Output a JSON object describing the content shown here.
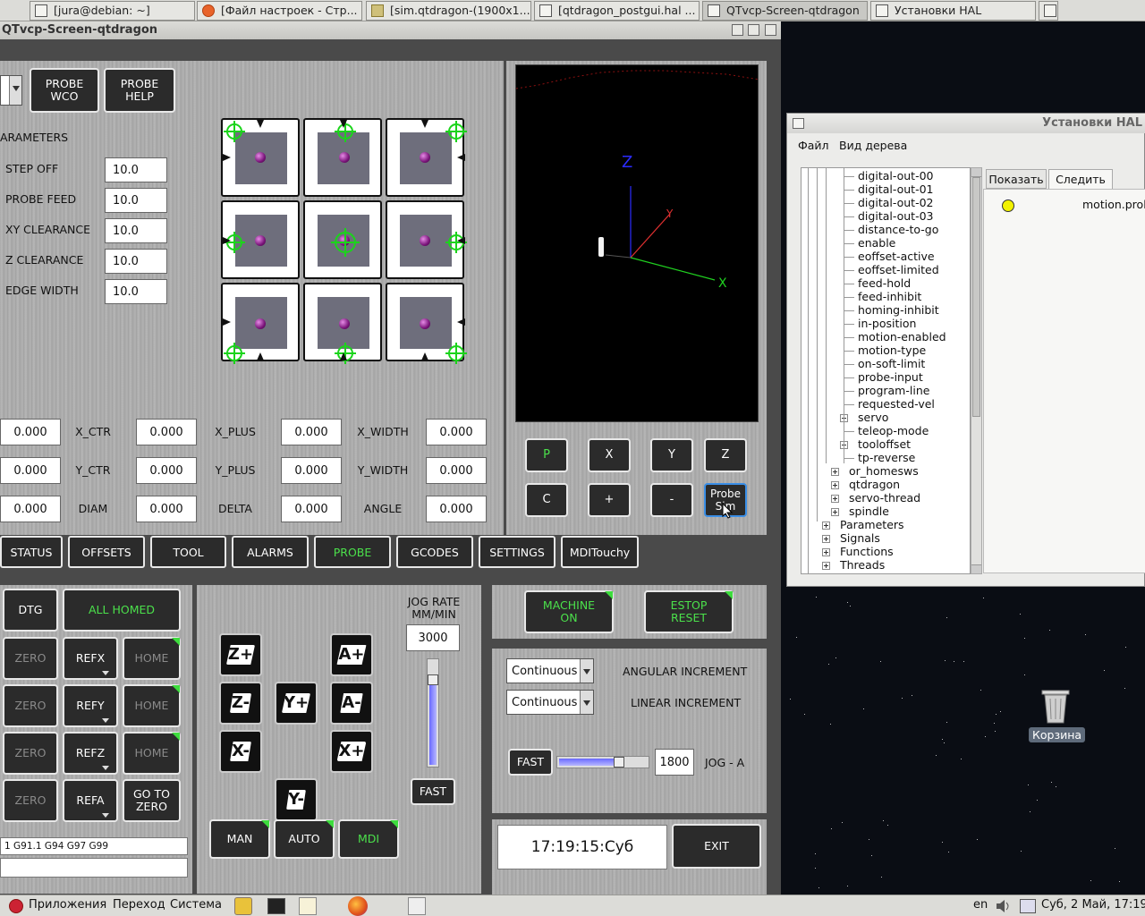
{
  "taskbar_top": {
    "items": [
      {
        "label": "[jura@debian: ~]",
        "icon": "terminal-icon"
      },
      {
        "label": "[Файл настроек - Стр...",
        "icon": "firefox-icon"
      },
      {
        "label": "[sim.qtdragon-(1900x1...",
        "icon": "folder-icon"
      },
      {
        "label": "[qtdragon_postgui.hal ...",
        "icon": "text-editor-icon"
      },
      {
        "label": "QTvcp-Screen-qtdragon",
        "icon": "window-icon"
      },
      {
        "label": "Установки HAL",
        "icon": "window-icon"
      }
    ]
  },
  "qt_window": {
    "title": "QTvcp-Screen-qtdragon",
    "probe_buttons": [
      "PROBE\nWCO",
      "PROBE\nHELP"
    ],
    "parameters_title": "ARAMETERS",
    "parameters": [
      {
        "label": "STEP OFF",
        "value": "10.0"
      },
      {
        "label": "PROBE FEED",
        "value": "10.0"
      },
      {
        "label": "XY CLEARANCE",
        "value": "10.0"
      },
      {
        "label": "Z CLEARANCE",
        "value": "10.0"
      },
      {
        "label": "EDGE WIDTH",
        "value": "10.0"
      }
    ],
    "results": [
      [
        {
          "v": "0.000"
        },
        {
          "l": "X_CTR"
        },
        {
          "v": "0.000"
        },
        {
          "l": "X_PLUS"
        },
        {
          "v": "0.000"
        },
        {
          "l": "X_WIDTH"
        },
        {
          "v": "0.000"
        }
      ],
      [
        {
          "v": "0.000"
        },
        {
          "l": "Y_CTR"
        },
        {
          "v": "0.000"
        },
        {
          "l": "Y_PLUS"
        },
        {
          "v": "0.000"
        },
        {
          "l": "Y_WIDTH"
        },
        {
          "v": "0.000"
        }
      ],
      [
        {
          "v": "0.000"
        },
        {
          "l": "DIAM"
        },
        {
          "v": "0.000"
        },
        {
          "l": "DELTA"
        },
        {
          "v": "0.000"
        },
        {
          "l": "ANGLE"
        },
        {
          "v": "0.000"
        }
      ]
    ],
    "view_buttons": [
      "P",
      "X",
      "Y",
      "Z",
      "C",
      "+",
      "-",
      "Probe\nSim"
    ],
    "axis_labels": {
      "x": "X",
      "y": "Y",
      "z": "Z"
    },
    "tabs": [
      "STATUS",
      "OFFSETS",
      "TOOL",
      "ALARMS",
      "PROBE",
      "GCODES",
      "SETTINGS",
      "MDITouchy"
    ],
    "active_tab": "PROBE",
    "dro": {
      "dtg": "DTG",
      "all_homed": "ALL HOMED",
      "rows": [
        {
          "zero": "ZERO",
          "ref": "REFX",
          "home": "HOME"
        },
        {
          "zero": "ZERO",
          "ref": "REFY",
          "home": "HOME"
        },
        {
          "zero": "ZERO",
          "ref": "REFZ",
          "home": "HOME"
        },
        {
          "zero": "ZERO",
          "ref": "REFA",
          "home": "GO TO\nZERO"
        }
      ],
      "gcode_line": "1 G91.1 G94 G97 G99"
    },
    "jog": {
      "buttons": [
        "Z+",
        "Z-",
        "A+",
        "A-",
        "Y+",
        "X-",
        "X+",
        "Y-"
      ],
      "rate_label": "JOG RATE\nMM/MIN",
      "rate_value": "3000",
      "rate_slider_fraction": 0.84,
      "fast_label": "FAST",
      "modes": [
        "MAN",
        "AUTO",
        "MDI"
      ],
      "active_mode": "MDI"
    },
    "machine": {
      "machine_on": "MACHINE\nON",
      "estop_reset": "ESTOP\nRESET",
      "angular_increment_value": "Continuous",
      "angular_increment_label": "ANGULAR INCREMENT",
      "linear_increment_value": "Continuous",
      "linear_increment_label": "LINEAR INCREMENT",
      "fast_label": "FAST",
      "jog_a_value": "1800",
      "jog_a_label": "JOG - A",
      "jog_a_slider_fraction": 0.72
    },
    "clock": "17:19:15:Суб",
    "exit_label": "EXIT"
  },
  "hal_window": {
    "title": "Установки HAL",
    "menu": [
      "Файл",
      "Вид дерева"
    ],
    "tree_items": [
      {
        "label": "digital-out-00",
        "level": 3
      },
      {
        "label": "digital-out-01",
        "level": 3
      },
      {
        "label": "digital-out-02",
        "level": 3
      },
      {
        "label": "digital-out-03",
        "level": 3
      },
      {
        "label": "distance-to-go",
        "level": 3
      },
      {
        "label": "enable",
        "level": 3
      },
      {
        "label": "eoffset-active",
        "level": 3
      },
      {
        "label": "eoffset-limited",
        "level": 3
      },
      {
        "label": "feed-hold",
        "level": 3
      },
      {
        "label": "feed-inhibit",
        "level": 3
      },
      {
        "label": "homing-inhibit",
        "level": 3
      },
      {
        "label": "in-position",
        "level": 3
      },
      {
        "label": "motion-enabled",
        "level": 3
      },
      {
        "label": "motion-type",
        "level": 3
      },
      {
        "label": "on-soft-limit",
        "level": 3
      },
      {
        "label": "probe-input",
        "level": 3
      },
      {
        "label": "program-line",
        "level": 3
      },
      {
        "label": "requested-vel",
        "level": 3
      },
      {
        "label": "servo",
        "level": 3,
        "expandable": true
      },
      {
        "label": "teleop-mode",
        "level": 3
      },
      {
        "label": "tooloffset",
        "level": 3,
        "expandable": true
      },
      {
        "label": "tp-reverse",
        "level": 3
      },
      {
        "label": "or_homesws",
        "level": 2,
        "expandable": true
      },
      {
        "label": "qtdragon",
        "level": 2,
        "expandable": true
      },
      {
        "label": "servo-thread",
        "level": 2,
        "expandable": true
      },
      {
        "label": "spindle",
        "level": 2,
        "expandable": true
      },
      {
        "label": "Parameters",
        "level": 1,
        "expandable": true
      },
      {
        "label": "Signals",
        "level": 1,
        "expandable": true
      },
      {
        "label": "Functions",
        "level": 1,
        "expandable": true
      },
      {
        "label": "Threads",
        "level": 1,
        "expandable": true
      }
    ],
    "tabs": [
      "Показать",
      "Следить"
    ],
    "active_tab": "Следить",
    "watch_item": "motion.prob",
    "watch_led_color": "#f2f200"
  },
  "desktop": {
    "trash_label": "Корзина"
  },
  "taskbar_bottom": {
    "menus": [
      "Приложения",
      "Переход",
      "Система"
    ],
    "lang": "en",
    "datetime": "Суб,  2 Май, 17:19"
  }
}
